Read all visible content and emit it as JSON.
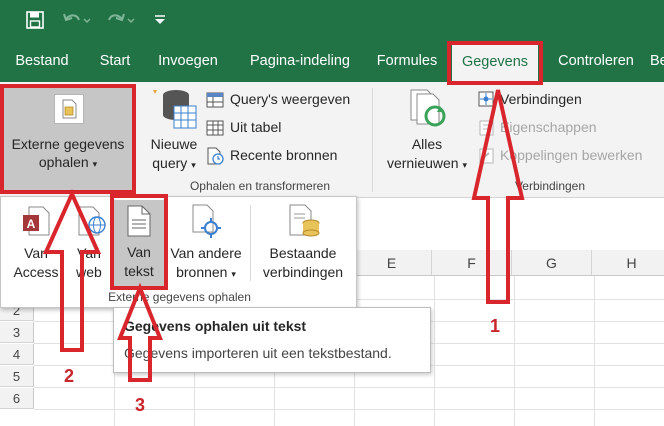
{
  "quick_access": {
    "save_icon": "save-icon",
    "undo_icon": "undo-icon",
    "redo_icon": "redo-icon",
    "customize_icon": "customize-qat-icon"
  },
  "tabs": [
    {
      "label": "Bestand",
      "active": false
    },
    {
      "label": "Start",
      "active": false
    },
    {
      "label": "Invoegen",
      "active": false
    },
    {
      "label": "Pagina-indeling",
      "active": false
    },
    {
      "label": "Formules",
      "active": false
    },
    {
      "label": "Gegevens",
      "active": true
    },
    {
      "label": "Controleren",
      "active": false
    },
    {
      "label": "Be",
      "active": false
    }
  ],
  "ribbon": {
    "external_data": {
      "line1": "Externe gegevens",
      "line2": "ophalen",
      "caret": "▾"
    },
    "new_query": {
      "line1": "Nieuwe",
      "line2": "query",
      "caret": "▾"
    },
    "show_queries": "Query's weergeven",
    "from_table": "Uit tabel",
    "recent_sources": "Recente bronnen",
    "group_get_transform": "Ophalen en transformeren",
    "refresh_all": {
      "line1": "Alles",
      "line2": "vernieuwen",
      "caret": "▾"
    },
    "connections": "Verbindingen",
    "properties": "Eigenschappen",
    "edit_links": "Koppelingen bewerken",
    "group_connections": "Verbindingen"
  },
  "dropdown": {
    "from_access": {
      "line1": "Van",
      "line2": "Access"
    },
    "from_web": {
      "line1": "Van",
      "line2": "web"
    },
    "from_text": {
      "line1": "Van",
      "line2": "tekst"
    },
    "from_other": {
      "line1": "Van andere",
      "line2": "bronnen",
      "caret": "▾"
    },
    "existing_connections": {
      "line1": "Bestaande",
      "line2": "verbindingen"
    },
    "group_label": "Externe gegevens ophalen"
  },
  "tooltip": {
    "title": "Gegevens ophalen uit tekst",
    "description": "Gegevens importeren uit een tekstbestand."
  },
  "sheet": {
    "columns": [
      "E",
      "F",
      "G",
      "H"
    ],
    "rows": [
      "2",
      "3",
      "4",
      "5",
      "6"
    ]
  },
  "annotations": {
    "step1": "1",
    "step2": "2",
    "step3": "3",
    "color": "#d9262c"
  },
  "colors": {
    "excel_green": "#217346",
    "ribbon_bg": "#f3f3f3",
    "annotation_red": "#d9262c"
  }
}
